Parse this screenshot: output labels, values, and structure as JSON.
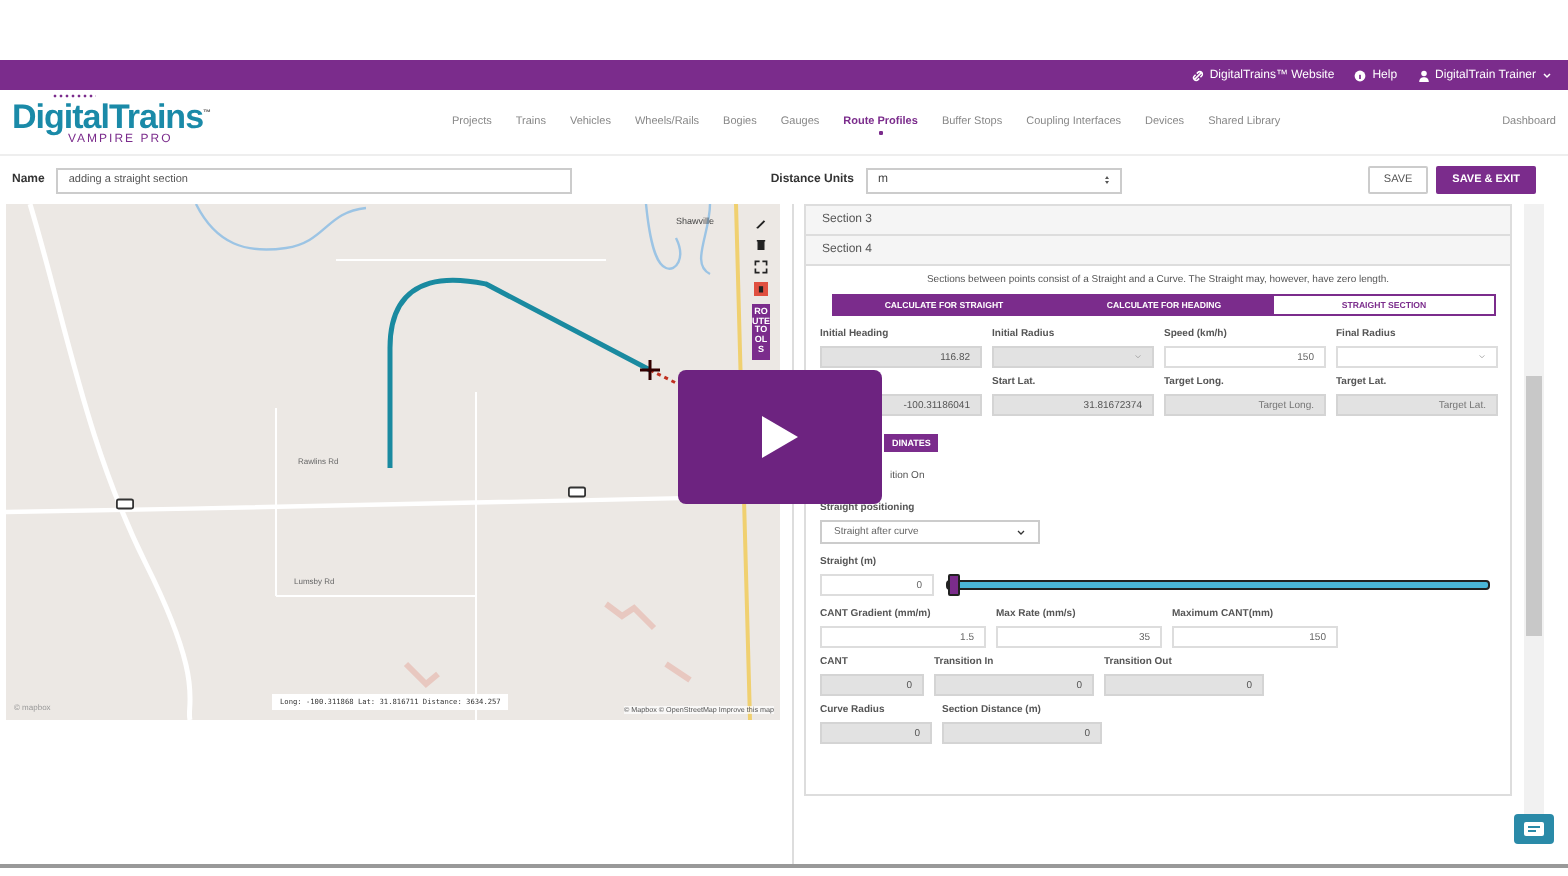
{
  "top_bar": {
    "links": [
      {
        "label": "DigitalTrains™ Website",
        "kind": "link"
      },
      {
        "label": "Help",
        "kind": "help"
      },
      {
        "label": "DigitalTrain Trainer",
        "kind": "user"
      }
    ]
  },
  "logo": {
    "title": "DigitalTrains",
    "subtitle": "VAMPIRE PRO",
    "tm": "™"
  },
  "nav": [
    {
      "label": "Projects",
      "selected": false
    },
    {
      "label": "Trains",
      "selected": false
    },
    {
      "label": "Vehicles",
      "selected": false
    },
    {
      "label": "Wheels/Rails",
      "selected": false
    },
    {
      "label": "Bogies",
      "selected": false
    },
    {
      "label": "Gauges",
      "selected": false
    },
    {
      "label": "Route Profiles",
      "selected": true
    },
    {
      "label": "Buffer Stops",
      "selected": false
    },
    {
      "label": "Coupling Interfaces",
      "selected": false
    },
    {
      "label": "Devices",
      "selected": false
    },
    {
      "label": "Shared Library",
      "selected": false
    }
  ],
  "dashboard": "Dashboard",
  "name_field": {
    "label": "Name",
    "value": "adding a straight section"
  },
  "distance_units": {
    "label": "Distance Units",
    "value": "m"
  },
  "buttons": [
    {
      "label": "SAVE",
      "kind": "plain"
    },
    {
      "label": "SAVE & EXIT",
      "kind": "primary"
    }
  ],
  "map": {
    "places": [
      {
        "label": "Shawville",
        "kind": "place"
      },
      {
        "label": "Rawlins Rd",
        "kind": "road"
      },
      {
        "label": "Lumsby Rd",
        "kind": "road"
      }
    ],
    "coordinates": "Long: -100.311868  Lat: 31.816711  Distance: 3634.257",
    "attribution": "© Mapbox © OpenStreetMap Improve this map",
    "brand": "© mapbox",
    "route_tools": "ROUTE TOOLS"
  },
  "sections": [
    {
      "title": "Section 3"
    },
    {
      "title": "Section 4"
    }
  ],
  "intro": "Sections between points consist of a Straight and a Curve. The Straight may, however, have zero length.",
  "modes": [
    {
      "label": "CALCULATE FOR STRAIGHT",
      "selected": true
    },
    {
      "label": "CALCULATE FOR HEADING",
      "selected": true
    },
    {
      "label": "STRAIGHT SECTION",
      "selected": false
    }
  ],
  "rows": [
    {
      "fields": [
        {
          "label": "Initial Heading",
          "value": "116.82",
          "kind": "input",
          "disabled": true
        },
        {
          "label": "Initial Radius",
          "kind": "select",
          "disabled": true
        },
        {
          "label": "Speed (km/h)",
          "value": "150",
          "kind": "input",
          "disabled": false
        },
        {
          "label": "Final Radius",
          "kind": "select",
          "disabled": false
        }
      ]
    },
    {
      "fields": [
        {
          "value": "-100.31186041",
          "kind": "input",
          "disabled": true
        },
        {
          "label": "Start Lat.",
          "value": "31.81672374",
          "kind": "input",
          "disabled": true
        },
        {
          "label": "Target Long.",
          "placeholder": "Target Long.",
          "kind": "input",
          "disabled": true
        },
        {
          "label": "Target Lat.",
          "placeholder": "Target Lat.",
          "kind": "input",
          "disabled": true
        }
      ]
    }
  ],
  "coord_button": "DINATES",
  "transition_text": "ition On",
  "positioning": {
    "label": "Straight positioning",
    "value": "Straight after curve"
  },
  "straight": {
    "label": "Straight (m)",
    "value": "0",
    "level": 0.0
  },
  "rows2": [
    {
      "fields": [
        {
          "label": "CANT Gradient (mm/m)",
          "value": "1.5",
          "disabled": false
        },
        {
          "label": "Max Rate (mm/s)",
          "value": "35",
          "disabled": false
        },
        {
          "label": "Maximum CANT(mm)",
          "value": "150",
          "disabled": false
        }
      ]
    },
    {
      "fields": [
        {
          "label": "CANT",
          "value": "0",
          "disabled": true
        },
        {
          "label": "Transition In",
          "value": "0",
          "disabled": true
        },
        {
          "label": "Transition Out",
          "value": "0",
          "disabled": true
        }
      ]
    },
    {
      "fields": [
        {
          "label": "Curve Radius",
          "value": "0",
          "disabled": true
        },
        {
          "label": "Section Distance (m)",
          "value": "0",
          "disabled": true
        }
      ]
    }
  ]
}
